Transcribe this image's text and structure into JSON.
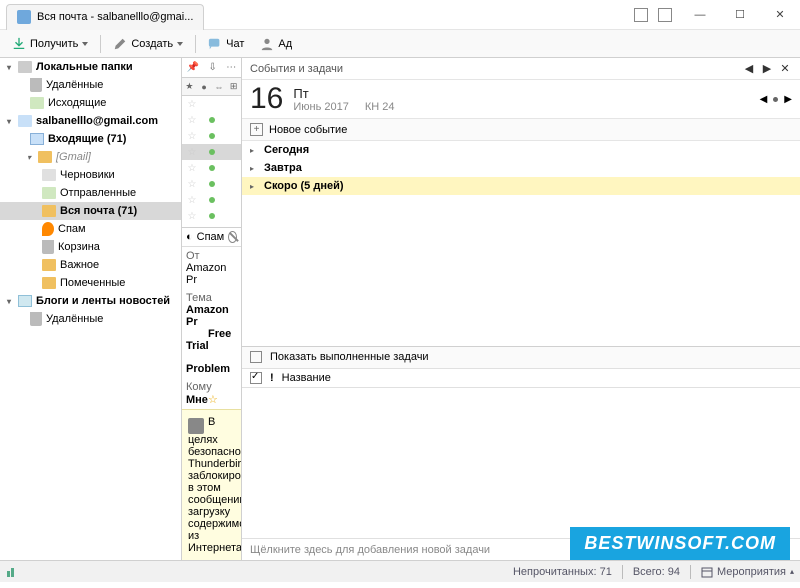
{
  "tab": {
    "title": "Вся почта - salbanelllo@gmai..."
  },
  "window_controls": {
    "min": "—",
    "max": "☐",
    "close": "✕"
  },
  "toolbar": {
    "receive": "Получить",
    "create": "Создать",
    "chat": "Чат",
    "address": "Ад"
  },
  "tree": {
    "local": "Локальные папки",
    "local_deleted": "Удалённые",
    "local_outgoing": "Исходящие",
    "account": "salbanelllo@gmail.com",
    "inbox": "Входящие (71)",
    "gmail": "[Gmail]",
    "drafts": "Черновики",
    "sent": "Отправленные",
    "all_mail": "Вся почта (71)",
    "spam": "Спам",
    "trash": "Корзина",
    "important": "Важное",
    "starred": "Помеченные",
    "blogs": "Блоги и ленты новостей",
    "blogs_deleted": "Удалённые"
  },
  "msgcol": {
    "spam_btn": "Спам",
    "from_label": "От",
    "from_value": "Amazon Pr",
    "subject_label": "Тема",
    "subject_line1": "Amazon Pr",
    "subject_line2": "Free Trial",
    "subject_line3": "Problem",
    "to_label": "Кому",
    "to_value": "Мне",
    "preview": "В целях безопасност Thunderbird заблокирова в этом сообщении загрузку содержимог из Интернета"
  },
  "calendar": {
    "pane_title": "События и задачи",
    "big_date": "16",
    "weekday": "Пт",
    "month_year": "Июнь 2017",
    "week_no": "КН 24",
    "new_event": "Новое событие",
    "today": "Сегодня",
    "tomorrow": "Завтра",
    "soon": "Скоро (5 дней)",
    "show_completed": "Показать выполненные задачи",
    "title_col": "Название",
    "add_task_hint": "Щёлкните здесь для добавления новой задачи"
  },
  "status": {
    "unread": "Непрочитанных: 71",
    "total": "Всего: 94",
    "events": "Мероприятия"
  },
  "watermark": "BESTWINSOFT.COM"
}
